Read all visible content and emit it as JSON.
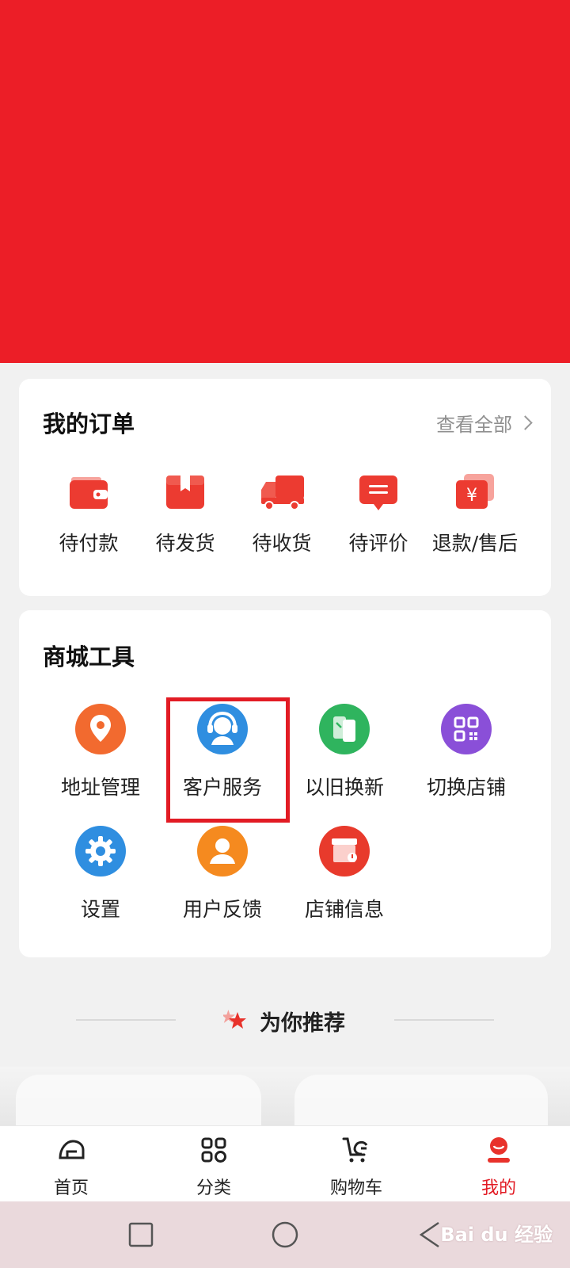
{
  "orders": {
    "title": "我的订单",
    "view_all": "查看全部",
    "items": [
      {
        "label": "待付款",
        "icon": "wallet-icon"
      },
      {
        "label": "待发货",
        "icon": "package-icon"
      },
      {
        "label": "待收货",
        "icon": "truck-icon"
      },
      {
        "label": "待评价",
        "icon": "comment-icon"
      },
      {
        "label": "退款/售后",
        "icon": "refund-icon"
      }
    ]
  },
  "tools": {
    "title": "商城工具",
    "items": [
      {
        "label": "地址管理",
        "icon": "location-icon",
        "color": "#f26a2f"
      },
      {
        "label": "客户服务",
        "icon": "customer-service-icon",
        "color": "#2f8ee0"
      },
      {
        "label": "以旧换新",
        "icon": "trade-in-icon",
        "color": "#2fb45e"
      },
      {
        "label": "切换店铺",
        "icon": "qr-code-icon",
        "color": "#8a4fd8"
      },
      {
        "label": "设置",
        "icon": "gear-icon",
        "color": "#2f8ee0"
      },
      {
        "label": "用户反馈",
        "icon": "user-icon",
        "color": "#f58a1f"
      },
      {
        "label": "店铺信息",
        "icon": "store-icon",
        "color": "#e83a2c"
      }
    ]
  },
  "recommend": {
    "title": "为你推荐"
  },
  "tabbar": {
    "items": [
      {
        "label": "首页",
        "icon": "home-icon"
      },
      {
        "label": "分类",
        "icon": "category-icon"
      },
      {
        "label": "购物车",
        "icon": "cart-icon"
      },
      {
        "label": "我的",
        "icon": "profile-icon",
        "active": true
      }
    ]
  },
  "watermark": "Bai du 经验",
  "colors": {
    "brand": "#ec1e27",
    "highlight": "#e21b24"
  }
}
